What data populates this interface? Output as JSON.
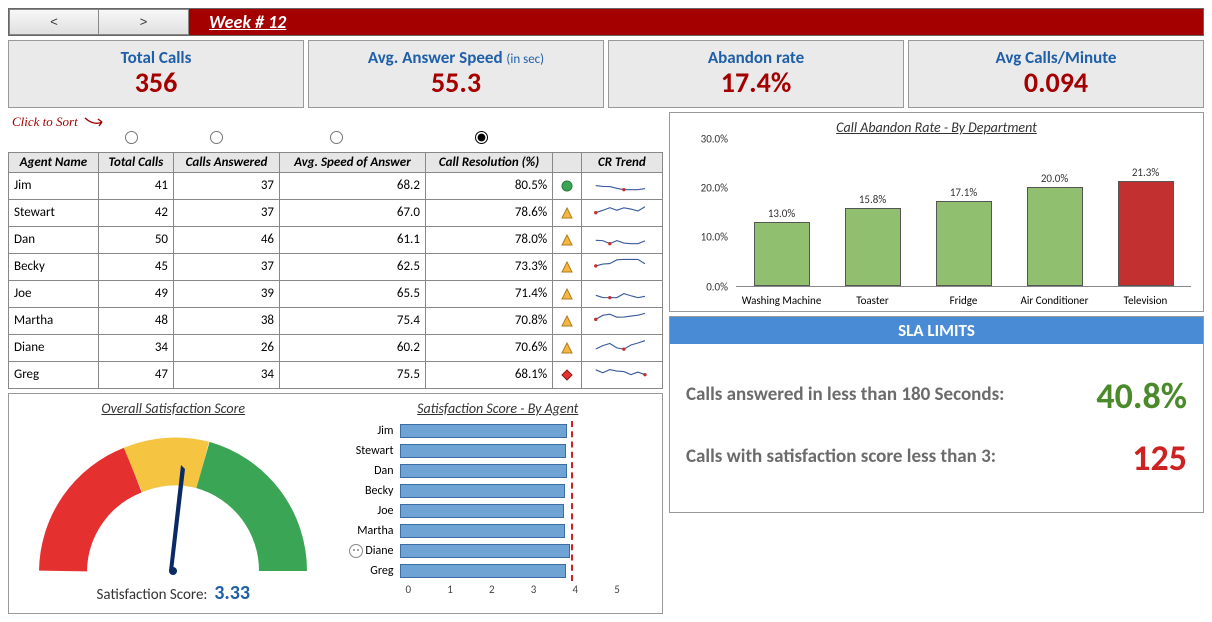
{
  "header": {
    "week_label": "Week # 12",
    "nav_prev": "<",
    "nav_next": ">"
  },
  "kpis": {
    "total_calls": {
      "title": "Total Calls",
      "value": "356"
    },
    "avg_answer": {
      "title": "Avg. Answer Speed",
      "suffix": "(in sec)",
      "value": "55.3"
    },
    "abandon": {
      "title": "Abandon rate",
      "value": "17.4%"
    },
    "cpm": {
      "title": "Avg Calls/Minute",
      "value": "0.094"
    }
  },
  "sort_hint": "Click to Sort",
  "table": {
    "headers": [
      "Agent Name",
      "Total Calls",
      "Calls Answered",
      "Avg. Speed of Answer",
      "Call Resolution (%)",
      "",
      "CR Trend"
    ],
    "rows": [
      {
        "name": "Jim",
        "tc": "41",
        "ca": "37",
        "asa": "68.2",
        "cr": "80.5%",
        "icon": "circle"
      },
      {
        "name": "Stewart",
        "tc": "42",
        "ca": "37",
        "asa": "67.0",
        "cr": "78.6%",
        "icon": "triangle"
      },
      {
        "name": "Dan",
        "tc": "50",
        "ca": "46",
        "asa": "61.1",
        "cr": "78.0%",
        "icon": "triangle"
      },
      {
        "name": "Becky",
        "tc": "45",
        "ca": "37",
        "asa": "62.5",
        "cr": "73.3%",
        "icon": "triangle"
      },
      {
        "name": "Joe",
        "tc": "49",
        "ca": "39",
        "asa": "65.5",
        "cr": "71.4%",
        "icon": "triangle"
      },
      {
        "name": "Martha",
        "tc": "48",
        "ca": "38",
        "asa": "75.4",
        "cr": "70.8%",
        "icon": "triangle"
      },
      {
        "name": "Diane",
        "tc": "34",
        "ca": "26",
        "asa": "60.2",
        "cr": "70.6%",
        "icon": "triangle"
      },
      {
        "name": "Greg",
        "tc": "47",
        "ca": "34",
        "asa": "75.5",
        "cr": "68.1%",
        "icon": "diamond"
      }
    ]
  },
  "gauge": {
    "title": "Overall Satisfaction Score",
    "label": "Satisfaction Score:",
    "value": "3.33"
  },
  "satbars": {
    "title": "Satisfaction Score - By Agent",
    "target": 3.3,
    "max": 5,
    "ticks": [
      "0",
      "1",
      "2",
      "3",
      "4",
      "5"
    ],
    "rows": [
      {
        "name": "Jim",
        "v": 3.35,
        "smile": false
      },
      {
        "name": "Stewart",
        "v": 3.32,
        "smile": false
      },
      {
        "name": "Dan",
        "v": 3.34,
        "smile": false
      },
      {
        "name": "Becky",
        "v": 3.3,
        "smile": false
      },
      {
        "name": "Joe",
        "v": 3.28,
        "smile": false
      },
      {
        "name": "Martha",
        "v": 3.3,
        "smile": false
      },
      {
        "name": "Diane",
        "v": 3.4,
        "smile": true
      },
      {
        "name": "Greg",
        "v": 3.32,
        "smile": false
      }
    ]
  },
  "sla": {
    "title": "SLA LIMITS",
    "row1_text": "Calls answered in less than 180 Seconds:",
    "row1_val": "40.8%",
    "row2_text": "Calls with satisfaction score less than 3:",
    "row2_val": "125"
  },
  "chart_data": {
    "type": "bar",
    "title": "Call Abandon Rate - By Department",
    "categories": [
      "Washing Machine",
      "Toaster",
      "Fridge",
      "Air Conditioner",
      "Television"
    ],
    "values": [
      13.0,
      15.8,
      17.1,
      20.0,
      21.3
    ],
    "value_labels": [
      "13.0%",
      "15.8%",
      "17.1%",
      "20.0%",
      "21.3%"
    ],
    "colors": [
      "#8fbf6f",
      "#8fbf6f",
      "#8fbf6f",
      "#8fbf6f",
      "#c23030"
    ],
    "ylabel": "",
    "xlabel": "",
    "ylim": [
      0,
      30
    ],
    "yticks": [
      "0.0%",
      "10.0%",
      "20.0%",
      "30.0%"
    ]
  }
}
